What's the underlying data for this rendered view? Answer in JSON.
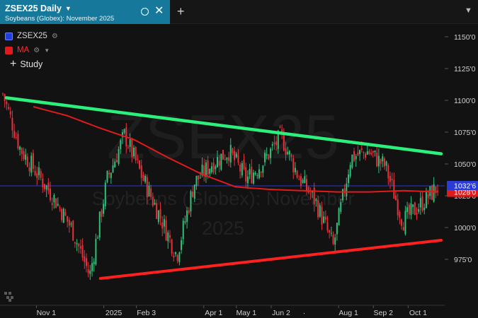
{
  "tab": {
    "title": "ZSEX25 Daily",
    "subtitle": "Soybeans (Globex): November 2025"
  },
  "legend": {
    "symbol_label": "ZSEX25",
    "ma_label": "MA",
    "study_label": "Study"
  },
  "watermark": {
    "symbol": "ZSEX25",
    "name": "Soybeans (Globex): November",
    "year": "2025"
  },
  "colors": {
    "tab_bg": "#16799b",
    "up_candle": "#2fc07a",
    "down_candle": "#e5313a",
    "ma_line": "#e01b1b",
    "upper_trend": "#2cf07c",
    "lower_trend": "#ff2020",
    "price_badge": "#2a3bd6"
  },
  "icons": [
    "chevron-down-icon",
    "circle-icon",
    "close-icon",
    "plus-icon",
    "gear-icon",
    "caret-down-icon"
  ],
  "chart_data": {
    "type": "candlestick",
    "x_labels": [
      "Nov 1",
      "2025",
      "Feb 3",
      "Apr 1",
      "May 1",
      "Jun 2",
      "Aug 1",
      "Sep 2",
      "Oct 1"
    ],
    "y_ticks": [
      "1150'0",
      "1125'0",
      "1100'0",
      "1075'0",
      "1050'0",
      "1025'0",
      "1000'0",
      "975'0"
    ],
    "y_values": [
      1150,
      1125,
      1100,
      1075,
      1050,
      1025,
      1000,
      975
    ],
    "ylim": [
      955,
      1155
    ],
    "last_price_label": "1032'6",
    "ma_value_label": "1028'0",
    "ma": [
      1095,
      1088,
      1078,
      1069,
      1055,
      1042,
      1032,
      1030,
      1029,
      1028,
      1028,
      1029,
      1028
    ],
    "close_path": [
      1105,
      1062,
      1042,
      1022,
      998,
      962,
      1038,
      1073,
      1040,
      1010,
      978,
      1035,
      1050,
      1060,
      1038,
      1052,
      1072,
      1040,
      1020,
      985,
      1055,
      1060,
      1048,
      1005,
      1018,
      1032
    ],
    "upper_trendline": [
      [
        0,
        1102
      ],
      [
        1,
        1058
      ]
    ],
    "lower_trendline": [
      [
        0.2,
        960
      ],
      [
        1,
        990
      ]
    ]
  }
}
